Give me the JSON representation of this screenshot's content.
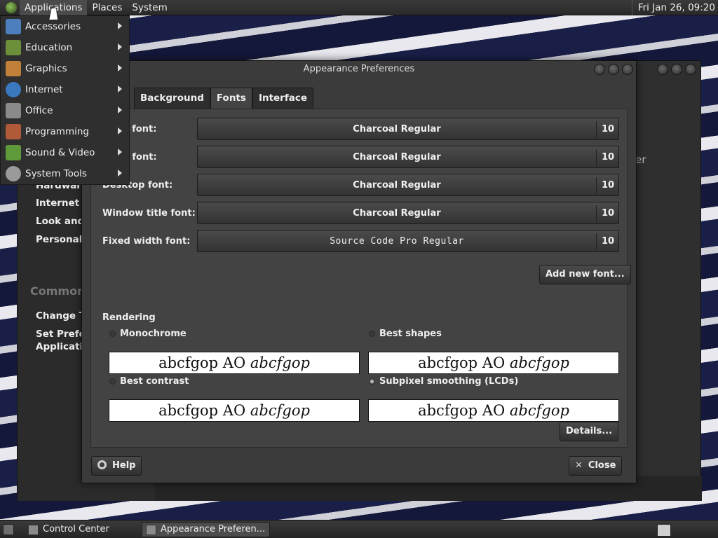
{
  "top_panel": {
    "menus": [
      "Applications",
      "Places",
      "System"
    ],
    "clock": "Fri Jan 26, 09:20"
  },
  "app_menu": {
    "items": [
      {
        "label": "Accessories",
        "icon": "accessories-icon",
        "color": "#4d7fbf"
      },
      {
        "label": "Education",
        "icon": "education-icon",
        "color": "#6c8f3a"
      },
      {
        "label": "Graphics",
        "icon": "graphics-icon",
        "color": "#c0803a"
      },
      {
        "label": "Internet",
        "icon": "internet-icon",
        "color": "#3a78c0"
      },
      {
        "label": "Office",
        "icon": "office-icon",
        "color": "#8a8a8a"
      },
      {
        "label": "Programming",
        "icon": "programming-icon",
        "color": "#b05a3a"
      },
      {
        "label": "Sound & Video",
        "icon": "sound-video-icon",
        "color": "#5f9a3a"
      },
      {
        "label": "System Tools",
        "icon": "system-tools-icon",
        "color": "#9a9a9a"
      }
    ]
  },
  "control_center": {
    "sidebar_items": [
      "Hardware",
      "Internet a",
      "Look and I",
      "Personal"
    ],
    "common_heading": "Common",
    "common_items": [
      "Change Th",
      "Set Prefer",
      "Applicatio"
    ],
    "right_fragment": "er"
  },
  "appearance": {
    "title": "Appearance Preferences",
    "tabs": [
      "Background",
      "Fonts",
      "Interface"
    ],
    "active_tab": "Fonts",
    "fonts": [
      {
        "label": "ation font:",
        "name": "Charcoal Regular",
        "size": "10"
      },
      {
        "label": "ment font:",
        "name": "Charcoal Regular",
        "size": "10"
      },
      {
        "label": "Desktop font:",
        "name": "Charcoal Regular",
        "size": "10"
      },
      {
        "label": "Window title font:",
        "name": "Charcoal Regular",
        "size": "10"
      },
      {
        "label": "Fixed width font:",
        "name": "Source Code Pro Regular",
        "size": "10"
      }
    ],
    "add_font_label": "Add new font...",
    "rendering_label": "Rendering",
    "rendering_options": [
      {
        "label": "Monochrome",
        "selected": false
      },
      {
        "label": "Best shapes",
        "selected": false
      },
      {
        "label": "Best contrast",
        "selected": false
      },
      {
        "label": "Subpixel smoothing (LCDs)",
        "selected": true
      }
    ],
    "sample_text": "abcfgop AO",
    "sample_italic": "abcfgop",
    "details_label": "Details...",
    "help_label": "Help",
    "close_label": "Close"
  },
  "taskbar": {
    "tasks": [
      "Control Center",
      "Appearance Preferen..."
    ]
  }
}
